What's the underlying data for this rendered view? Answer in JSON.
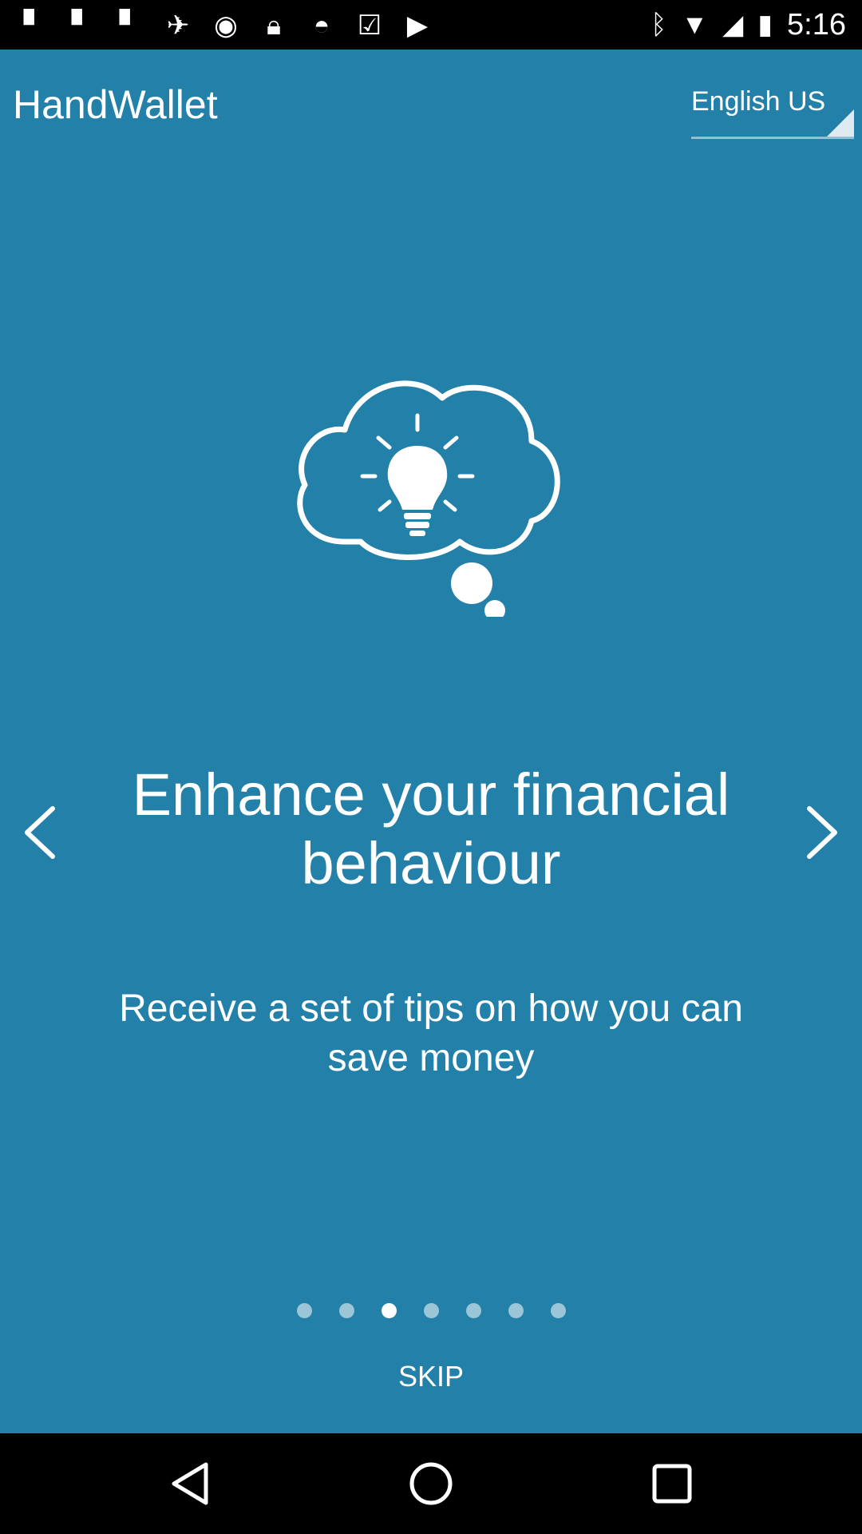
{
  "status_bar": {
    "time": "5:16",
    "left_icons": [
      "notification-icon",
      "notification-icon",
      "notification-icon",
      "fake-gps-icon",
      "sync-icon",
      "lock-icon",
      "android-icon",
      "check-icon",
      "play-store-icon"
    ],
    "right_icons": [
      "bluetooth-icon"
    ]
  },
  "header": {
    "app_title": "HandWallet",
    "language": "English US"
  },
  "onboarding": {
    "headline": "Enhance your financial behaviour",
    "description": "Receive a set of tips on how you can save money",
    "page_count": 7,
    "current_page": 3
  },
  "actions": {
    "skip_label": "SKIP"
  },
  "colors": {
    "background": "#2380a8",
    "foreground": "#ffffff"
  }
}
